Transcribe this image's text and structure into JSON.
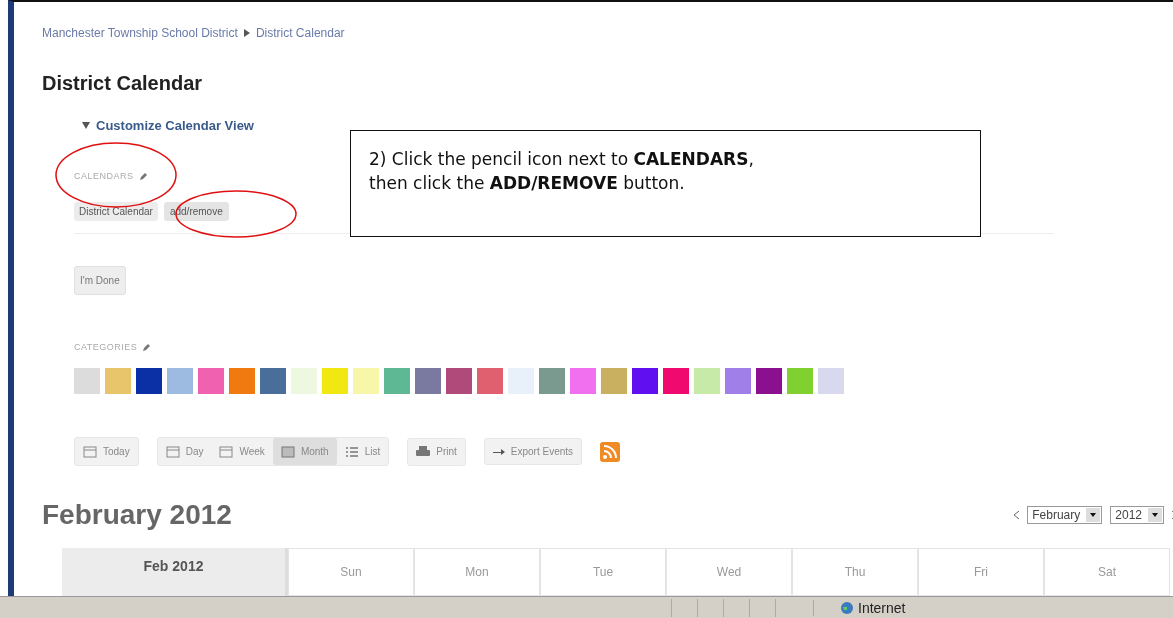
{
  "breadcrumb": [
    "Manchester Township School District",
    "District Calendar"
  ],
  "title": "District Calendar",
  "customize": {
    "label": "Customize Calendar View",
    "expanded": true
  },
  "calendars": {
    "label": "CALENDARS",
    "items": [
      "District Calendar"
    ],
    "add_button": "add/remove"
  },
  "done_button": "I'm Done",
  "categories": {
    "label": "CATEGORIES",
    "swatches": [
      {
        "color": "#dcdcdc"
      },
      {
        "color": "#e8c46a"
      },
      {
        "color": "#0b2fa5"
      },
      {
        "color": "#9dbbe0"
      },
      {
        "color": "#f062b0"
      },
      {
        "color": "#f07a10"
      },
      {
        "color": "#4a6e9a"
      },
      {
        "color": "#eef7e0"
      },
      {
        "color": "#f0e810"
      },
      {
        "color": "#f8f6a8"
      },
      {
        "color": "#5fb894"
      },
      {
        "color": "#7a7aa0"
      },
      {
        "color": "#b04a7a"
      },
      {
        "color": "#e06070"
      },
      {
        "color": "#e8f0fa"
      },
      {
        "color": "#7a9a90"
      },
      {
        "color": "#f070f0"
      },
      {
        "color": "#c8b060"
      },
      {
        "color": "#6010f0"
      },
      {
        "color": "#f00a70"
      },
      {
        "color": "#c8eaa8"
      },
      {
        "color": "#a080e8"
      },
      {
        "color": "#8a1090"
      },
      {
        "color": "#80d030"
      },
      {
        "color": "#d8d8ee"
      }
    ]
  },
  "toolbar": {
    "today": "Today",
    "views": [
      {
        "label": "Day",
        "selected": false,
        "kind": "day"
      },
      {
        "label": "Week",
        "selected": false,
        "kind": "week"
      },
      {
        "label": "Month",
        "selected": true,
        "kind": "month"
      },
      {
        "label": "List",
        "selected": false,
        "kind": "list"
      }
    ],
    "print": "Print",
    "export": "Export Events"
  },
  "month_title": "February 2012",
  "month_select": "February",
  "year_select": "2012",
  "calendar": {
    "corner": "Feb 2012",
    "days": [
      "Sun",
      "Mon",
      "Tue",
      "Wed",
      "Thu",
      "Fri",
      "Sat"
    ]
  },
  "status_bar": {
    "zone": "Internet"
  },
  "annotation": {
    "text": "2) Click the pencil icon next to **CALENDARS**,\nthen click the **ADD/REMOVE** button."
  }
}
